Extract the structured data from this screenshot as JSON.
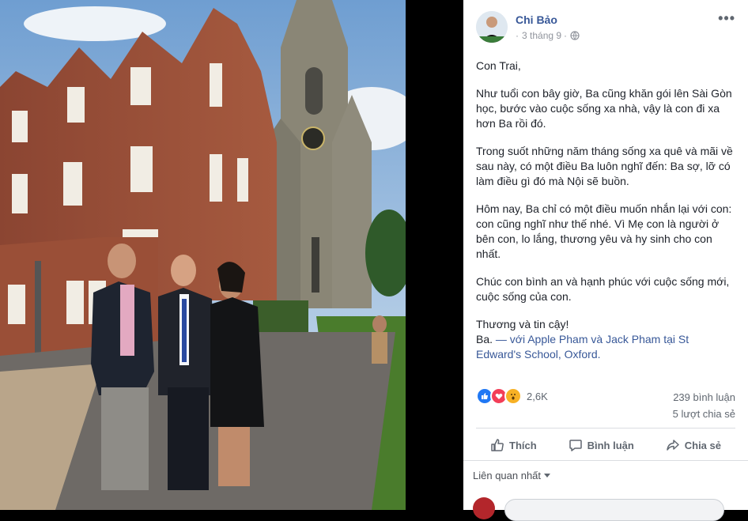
{
  "post": {
    "author": "Chi Bảo",
    "date": "3 tháng 9",
    "paragraphs": [
      "Con Trai,",
      "Như tuổi con bây giờ, Ba cũng khăn gói lên Sài Gòn học, bước vào cuộc sống xa nhà, vậy là con đi xa hơn Ba rồi đó.",
      "Trong suốt những năm tháng sống xa quê và mãi về sau này, có một điều Ba luôn nghĩ đến: Ba sợ, lỡ có làm điều gì đó mà Nội sẽ buồn.",
      "Hôm nay, Ba chỉ có một điều muốn nhắn lại với con: con cũng nghĩ như thế nhé. Vì Mẹ con là người ở bên con, lo lắng, thương yêu và hy sinh cho con nhất.",
      "Chúc con bình an và hạnh phúc với cuộc sống mới, cuộc sống của con.",
      "Thương và tin cậy!"
    ],
    "signature": {
      "name": "Ba.",
      "with_prefix": "— với",
      "tag1": "Apple Pham",
      "and_word": "và",
      "tag2": "Jack Pham",
      "at_word": "tại",
      "location": "St Edward's School, Oxford",
      "end": "."
    }
  },
  "stats": {
    "reaction_count": "2,6K",
    "comments": "239 bình luận",
    "shares": "5 lượt chia sẻ",
    "reaction_icons": [
      "like-icon",
      "love-icon",
      "wow-icon"
    ],
    "colors": {
      "like": "#2078f4",
      "love": "#f33e58",
      "wow": "#f7b125"
    }
  },
  "actions": {
    "like": "Thích",
    "comment": "Bình luận",
    "share": "Chia sẻ"
  },
  "related": {
    "label": "Liên quan nhất"
  }
}
